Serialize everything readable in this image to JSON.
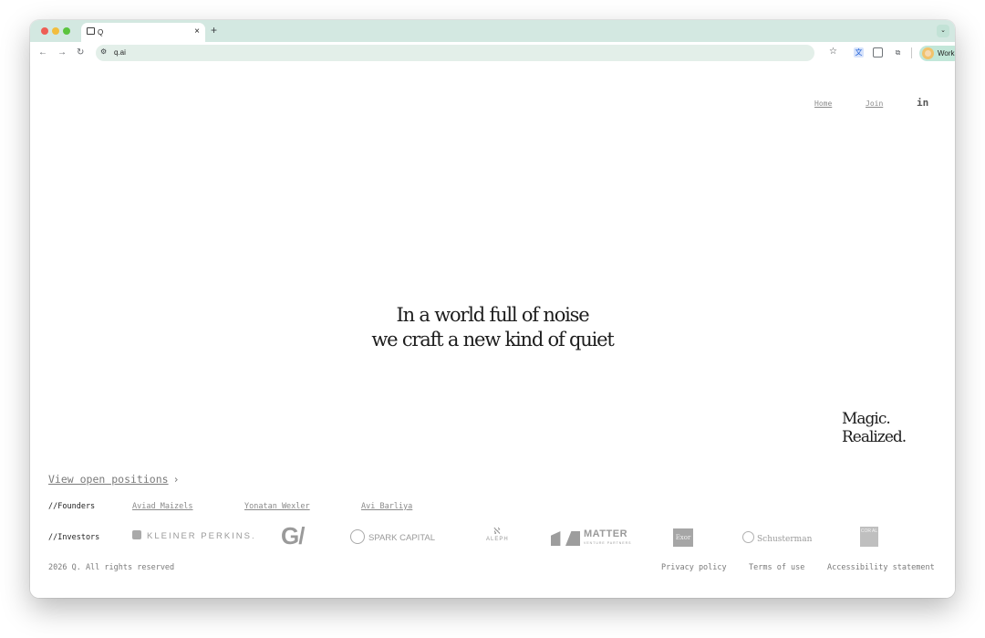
{
  "browser": {
    "tab_title": "Q",
    "tab_close": "×",
    "new_tab": "+",
    "tab_search": "⌄",
    "url": "q.ai",
    "profile_label": "Work"
  },
  "nav": {
    "home": "Home",
    "join": "Join",
    "linkedin": "in"
  },
  "hero": {
    "line1": "In a world full of noise",
    "line2": "we craft a new kind of quiet"
  },
  "tagline": "Magic. Realized.",
  "positions": {
    "label": "View open positions",
    "chevron": "›"
  },
  "founders": {
    "label": "//Founders",
    "names": [
      "Aviad Maizels",
      "Yonatan Wexler",
      "Avi Barliya"
    ]
  },
  "investors": {
    "label": "//Investors",
    "logos": {
      "kleiner": "KLEINER PERKINS.",
      "gv": "G/",
      "spark": "SPARK CAPITAL",
      "aleph": "ALEPH",
      "matter": "MATTER",
      "matter_sub": "VENTURE PARTNERS",
      "exor": "Exor",
      "schusterman": "Schusterman",
      "coral": "COR AL"
    }
  },
  "footer": {
    "copyright": "2026 Q. All rights reserved",
    "privacy": "Privacy policy",
    "terms": "Terms of use",
    "accessibility": "Accessibility statement"
  },
  "colors": {
    "tabstrip": "#d3e8e1",
    "omnibox": "#e3efe9",
    "text_dark": "#1d1d1d",
    "text_muted": "#7a7a7a"
  }
}
